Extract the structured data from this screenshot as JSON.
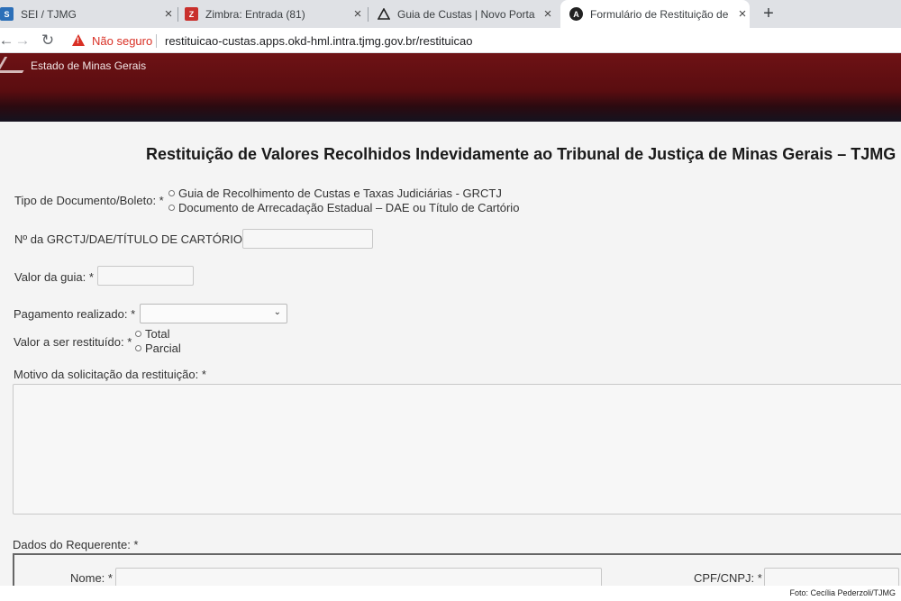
{
  "browser": {
    "tabs": [
      {
        "title": "SEI / TJMG",
        "close": "×"
      },
      {
        "title": "Zimbra: Entrada (81)",
        "close": "×"
      },
      {
        "title": "Guia de Custas | Novo Portal TJMG",
        "close": "×"
      },
      {
        "title": "Formulário de Restituição de Custas",
        "close": "×"
      }
    ],
    "new_tab": "+",
    "not_secure": "Não seguro",
    "url": "restituicao-custas.apps.okd-hml.intra.tjmg.gov.br/restituicao"
  },
  "header": {
    "org": "Estado de Minas Gerais"
  },
  "form": {
    "title": "Restituição de Valores Recolhidos Indevidamente ao Tribunal de Justiça de Minas Gerais – TJMG",
    "tipo_documento": {
      "label": "Tipo de Documento/Boleto: *",
      "options": [
        "Guia de Recolhimento de Custas e Taxas Judiciárias - GRCTJ",
        "Documento de Arrecadação Estadual – DAE ou Título de Cartório"
      ]
    },
    "numero_label": "Nº da GRCTJ/DAE/TÍTULO DE CARTÓRIO: *",
    "valor_guia_label": "Valor da guia: *",
    "pagamento_label": "Pagamento realizado: *",
    "valor_restituido": {
      "label": "Valor a ser restituído: *",
      "options": [
        "Total",
        "Parcial"
      ]
    },
    "motivo_label": "Motivo da solicitação da restituição: *",
    "requerente": {
      "label": "Dados do Requerente: *",
      "nome_label": "Nome: *",
      "cpf_label": "CPF/CNPJ: *"
    }
  },
  "credit": "Foto: Cecília Pederzoli/TJMG"
}
